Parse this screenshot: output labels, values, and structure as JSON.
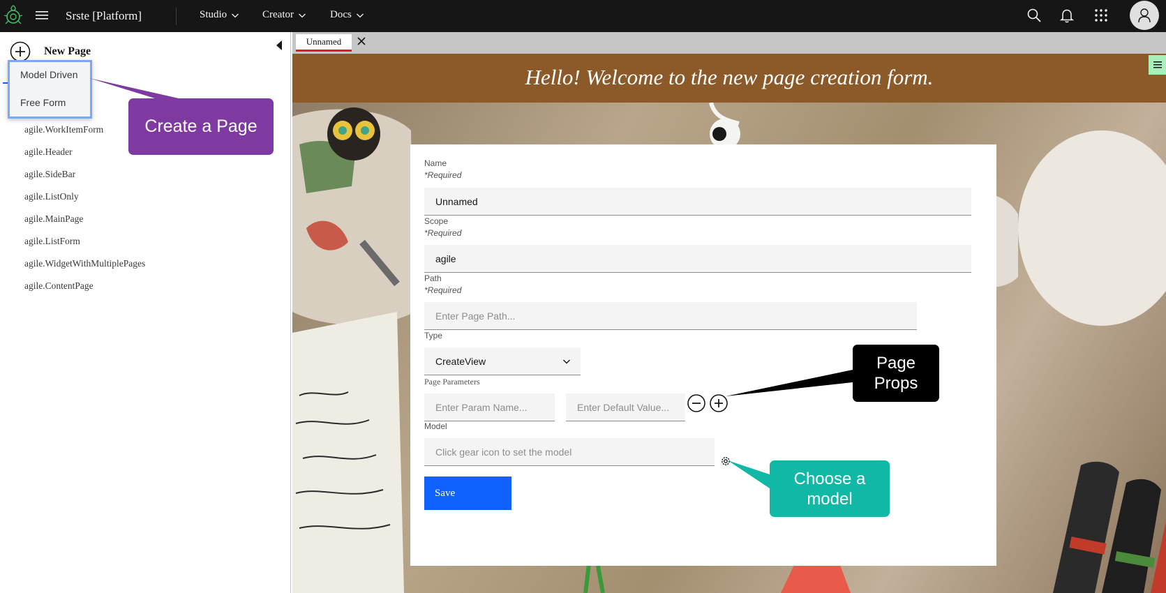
{
  "header": {
    "app_title": "Srste [Platform]",
    "nav": [
      {
        "label": "Studio"
      },
      {
        "label": "Creator"
      },
      {
        "label": "Docs"
      }
    ]
  },
  "left_panel": {
    "title": "New Page",
    "create_menu": [
      "Model Driven",
      "Free Form"
    ],
    "pages": [
      "agile.WorkItemForm",
      "agile.Header",
      "agile.SideBar",
      "agile.ListOnly",
      "agile.MainPage",
      "agile.ListForm",
      "agile.WidgetWithMultiplePages",
      "agile.ContentPage"
    ]
  },
  "callouts": {
    "create_page": "Create a Page",
    "page_props": "Page Props",
    "choose_model": "Choose a model"
  },
  "tabs": [
    {
      "label": "Unnamed",
      "active": true
    }
  ],
  "main": {
    "welcome": "Hello! Welcome to the new page creation form."
  },
  "form": {
    "required_note": "*Required",
    "name": {
      "label": "Name",
      "value": "Unnamed"
    },
    "scope": {
      "label": "Scope",
      "value": "agile"
    },
    "path": {
      "label": "Path",
      "placeholder": "Enter Page Path..."
    },
    "type": {
      "label": "Type",
      "value": "CreateView"
    },
    "page_parameters": {
      "label": "Page Parameters",
      "name_placeholder": "Enter Param Name...",
      "default_placeholder": "Enter Default Value..."
    },
    "model": {
      "label": "Model",
      "placeholder": "Click gear icon to set the model"
    },
    "save_label": "Save"
  },
  "colors": {
    "topbar": "#161616",
    "banner": "#8c5a28",
    "primary_button": "#0f62fe",
    "callout_create": "#7e3aa0",
    "callout_props": "#000000",
    "callout_model": "#12b8a6",
    "menu_highlight": "#78a9ff",
    "active_tab_underline": "#da1e28"
  }
}
